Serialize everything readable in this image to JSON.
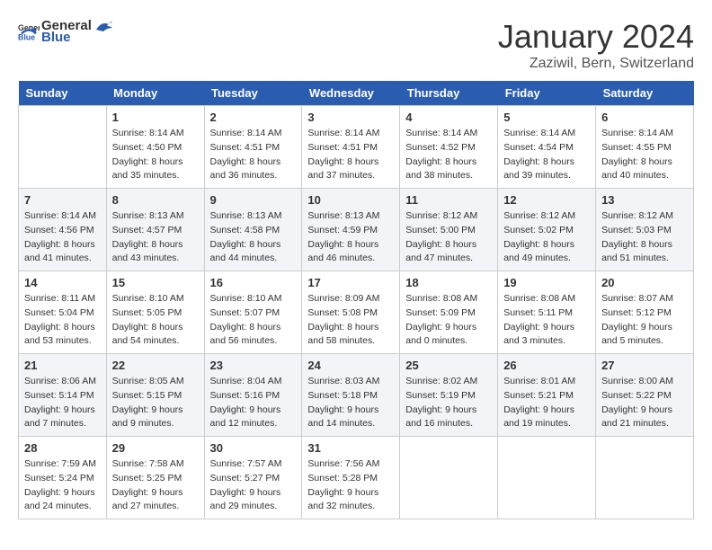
{
  "header": {
    "logo_general": "General",
    "logo_blue": "Blue",
    "title": "January 2024",
    "location": "Zaziwil, Bern, Switzerland"
  },
  "days_of_week": [
    "Sunday",
    "Monday",
    "Tuesday",
    "Wednesday",
    "Thursday",
    "Friday",
    "Saturday"
  ],
  "weeks": [
    [
      {
        "day": "",
        "sunrise": "",
        "sunset": "",
        "daylight": ""
      },
      {
        "day": "1",
        "sunrise": "Sunrise: 8:14 AM",
        "sunset": "Sunset: 4:50 PM",
        "daylight": "Daylight: 8 hours and 35 minutes."
      },
      {
        "day": "2",
        "sunrise": "Sunrise: 8:14 AM",
        "sunset": "Sunset: 4:51 PM",
        "daylight": "Daylight: 8 hours and 36 minutes."
      },
      {
        "day": "3",
        "sunrise": "Sunrise: 8:14 AM",
        "sunset": "Sunset: 4:51 PM",
        "daylight": "Daylight: 8 hours and 37 minutes."
      },
      {
        "day": "4",
        "sunrise": "Sunrise: 8:14 AM",
        "sunset": "Sunset: 4:52 PM",
        "daylight": "Daylight: 8 hours and 38 minutes."
      },
      {
        "day": "5",
        "sunrise": "Sunrise: 8:14 AM",
        "sunset": "Sunset: 4:54 PM",
        "daylight": "Daylight: 8 hours and 39 minutes."
      },
      {
        "day": "6",
        "sunrise": "Sunrise: 8:14 AM",
        "sunset": "Sunset: 4:55 PM",
        "daylight": "Daylight: 8 hours and 40 minutes."
      }
    ],
    [
      {
        "day": "7",
        "sunrise": "Sunrise: 8:14 AM",
        "sunset": "Sunset: 4:56 PM",
        "daylight": "Daylight: 8 hours and 41 minutes."
      },
      {
        "day": "8",
        "sunrise": "Sunrise: 8:13 AM",
        "sunset": "Sunset: 4:57 PM",
        "daylight": "Daylight: 8 hours and 43 minutes."
      },
      {
        "day": "9",
        "sunrise": "Sunrise: 8:13 AM",
        "sunset": "Sunset: 4:58 PM",
        "daylight": "Daylight: 8 hours and 44 minutes."
      },
      {
        "day": "10",
        "sunrise": "Sunrise: 8:13 AM",
        "sunset": "Sunset: 4:59 PM",
        "daylight": "Daylight: 8 hours and 46 minutes."
      },
      {
        "day": "11",
        "sunrise": "Sunrise: 8:12 AM",
        "sunset": "Sunset: 5:00 PM",
        "daylight": "Daylight: 8 hours and 47 minutes."
      },
      {
        "day": "12",
        "sunrise": "Sunrise: 8:12 AM",
        "sunset": "Sunset: 5:02 PM",
        "daylight": "Daylight: 8 hours and 49 minutes."
      },
      {
        "day": "13",
        "sunrise": "Sunrise: 8:12 AM",
        "sunset": "Sunset: 5:03 PM",
        "daylight": "Daylight: 8 hours and 51 minutes."
      }
    ],
    [
      {
        "day": "14",
        "sunrise": "Sunrise: 8:11 AM",
        "sunset": "Sunset: 5:04 PM",
        "daylight": "Daylight: 8 hours and 53 minutes."
      },
      {
        "day": "15",
        "sunrise": "Sunrise: 8:10 AM",
        "sunset": "Sunset: 5:05 PM",
        "daylight": "Daylight: 8 hours and 54 minutes."
      },
      {
        "day": "16",
        "sunrise": "Sunrise: 8:10 AM",
        "sunset": "Sunset: 5:07 PM",
        "daylight": "Daylight: 8 hours and 56 minutes."
      },
      {
        "day": "17",
        "sunrise": "Sunrise: 8:09 AM",
        "sunset": "Sunset: 5:08 PM",
        "daylight": "Daylight: 8 hours and 58 minutes."
      },
      {
        "day": "18",
        "sunrise": "Sunrise: 8:08 AM",
        "sunset": "Sunset: 5:09 PM",
        "daylight": "Daylight: 9 hours and 0 minutes."
      },
      {
        "day": "19",
        "sunrise": "Sunrise: 8:08 AM",
        "sunset": "Sunset: 5:11 PM",
        "daylight": "Daylight: 9 hours and 3 minutes."
      },
      {
        "day": "20",
        "sunrise": "Sunrise: 8:07 AM",
        "sunset": "Sunset: 5:12 PM",
        "daylight": "Daylight: 9 hours and 5 minutes."
      }
    ],
    [
      {
        "day": "21",
        "sunrise": "Sunrise: 8:06 AM",
        "sunset": "Sunset: 5:14 PM",
        "daylight": "Daylight: 9 hours and 7 minutes."
      },
      {
        "day": "22",
        "sunrise": "Sunrise: 8:05 AM",
        "sunset": "Sunset: 5:15 PM",
        "daylight": "Daylight: 9 hours and 9 minutes."
      },
      {
        "day": "23",
        "sunrise": "Sunrise: 8:04 AM",
        "sunset": "Sunset: 5:16 PM",
        "daylight": "Daylight: 9 hours and 12 minutes."
      },
      {
        "day": "24",
        "sunrise": "Sunrise: 8:03 AM",
        "sunset": "Sunset: 5:18 PM",
        "daylight": "Daylight: 9 hours and 14 minutes."
      },
      {
        "day": "25",
        "sunrise": "Sunrise: 8:02 AM",
        "sunset": "Sunset: 5:19 PM",
        "daylight": "Daylight: 9 hours and 16 minutes."
      },
      {
        "day": "26",
        "sunrise": "Sunrise: 8:01 AM",
        "sunset": "Sunset: 5:21 PM",
        "daylight": "Daylight: 9 hours and 19 minutes."
      },
      {
        "day": "27",
        "sunrise": "Sunrise: 8:00 AM",
        "sunset": "Sunset: 5:22 PM",
        "daylight": "Daylight: 9 hours and 21 minutes."
      }
    ],
    [
      {
        "day": "28",
        "sunrise": "Sunrise: 7:59 AM",
        "sunset": "Sunset: 5:24 PM",
        "daylight": "Daylight: 9 hours and 24 minutes."
      },
      {
        "day": "29",
        "sunrise": "Sunrise: 7:58 AM",
        "sunset": "Sunset: 5:25 PM",
        "daylight": "Daylight: 9 hours and 27 minutes."
      },
      {
        "day": "30",
        "sunrise": "Sunrise: 7:57 AM",
        "sunset": "Sunset: 5:27 PM",
        "daylight": "Daylight: 9 hours and 29 minutes."
      },
      {
        "day": "31",
        "sunrise": "Sunrise: 7:56 AM",
        "sunset": "Sunset: 5:28 PM",
        "daylight": "Daylight: 9 hours and 32 minutes."
      },
      {
        "day": "",
        "sunrise": "",
        "sunset": "",
        "daylight": ""
      },
      {
        "day": "",
        "sunrise": "",
        "sunset": "",
        "daylight": ""
      },
      {
        "day": "",
        "sunrise": "",
        "sunset": "",
        "daylight": ""
      }
    ]
  ]
}
